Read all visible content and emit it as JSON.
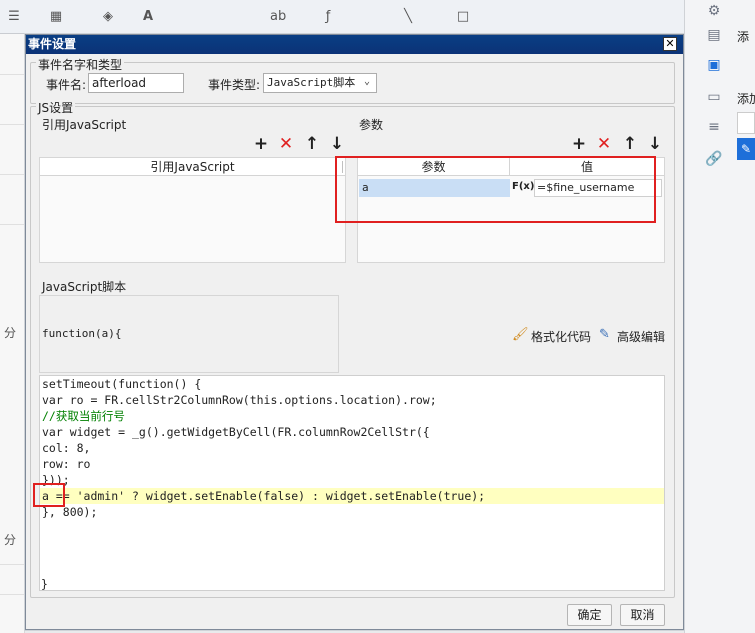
{
  "dialog": {
    "title": "事件设置",
    "close_symbol": "✕",
    "name_group_title": "事件名字和类型",
    "event_name_label": "事件名:",
    "event_name_value": "afterload",
    "event_type_label": "事件类型:",
    "event_type_value": "JavaScript脚本",
    "js_group_title": "JS设置",
    "ref_js_title": "引用JavaScript",
    "params_title": "参数",
    "ref_js_column": "引用JavaScript",
    "param_column": "参数",
    "value_column": "值",
    "param_row": {
      "name": "a",
      "formula_icon": "F(x)",
      "value": "=$fine_username"
    },
    "script_title": "JavaScript脚本",
    "function_signature": "function(a){",
    "format_code_label": "格式化代码",
    "advanced_edit_label": "高级编辑",
    "closing_brace": "}",
    "ok_label": "确定",
    "cancel_label": "取消"
  },
  "code_lines": [
    "setTimeout(function() {",
    "var ro = FR.cellStr2ColumnRow(this.options.location).row;",
    "//获取当前行号",
    "var widget = _g().getWidgetByCell(FR.columnRow2CellStr({",
    "col: 8,",
    "row: ro",
    "}));",
    "a == 'admin' ? widget.setEnable(false) : widget.setEnable(true);",
    "}, 800);"
  ],
  "background": {
    "left_labels": [
      "分",
      "分"
    ],
    "right_labels": [
      "添",
      "添加"
    ]
  },
  "colors": {
    "title_bar": "#0b3277",
    "highlight_box": "#e02020",
    "current_line": "#ffffc0"
  }
}
